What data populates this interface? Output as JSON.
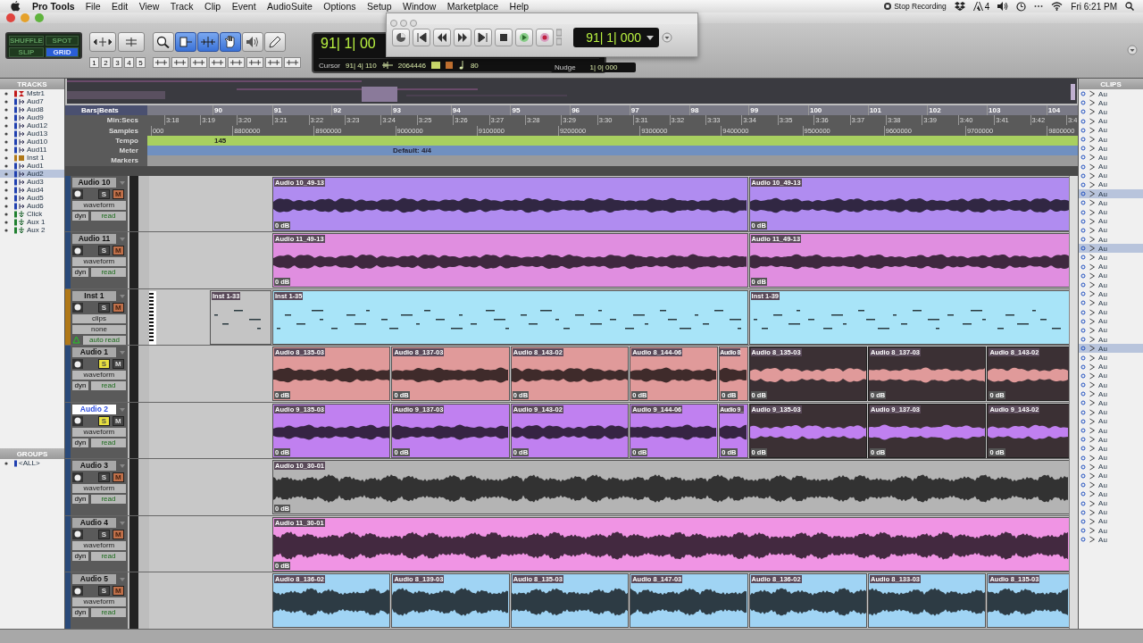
{
  "menu_bar": {
    "app": "Pro Tools",
    "menus": [
      "File",
      "Edit",
      "View",
      "Track",
      "Clip",
      "Event",
      "AudioSuite",
      "Options",
      "Setup",
      "Window",
      "Marketplace",
      "Help"
    ],
    "status": {
      "recording": "Stop Recording",
      "adobe_count": "4",
      "clock": "Fri 6:21 PM"
    }
  },
  "toolbar": {
    "edit_modes": [
      {
        "label": "SHUFFLE",
        "selected": false
      },
      {
        "label": "SPOT",
        "selected": false
      },
      {
        "label": "SLIP",
        "selected": false
      },
      {
        "label": "GRID",
        "selected": true
      }
    ],
    "zoom_presets": [
      "1",
      "2",
      "3",
      "4",
      "5"
    ],
    "tools": [
      {
        "kind": "zoom",
        "selected": false
      },
      {
        "kind": "trim",
        "selected": true
      },
      {
        "kind": "selector",
        "selected": true
      },
      {
        "kind": "grabber",
        "selected": true
      },
      {
        "kind": "scrub",
        "selected": false
      },
      {
        "kind": "pencil",
        "selected": false
      }
    ],
    "main_counter": "91| 1| 00",
    "cursor_label": "Cursor",
    "cursor_position": "91| 4| 110",
    "cursor_sample": "2064446",
    "tempo": "80"
  },
  "nudge": {
    "label": "Nudge",
    "value": "1| 0| 000"
  },
  "transport": {
    "counter": "91| 1| 000"
  },
  "tracks_panel": {
    "title": "TRACKS",
    "items": [
      {
        "label": "Mstr1",
        "kind": "master",
        "color": "#c01818",
        "selected": false
      },
      {
        "label": "Aud7",
        "kind": "audio",
        "color": "#2040b0",
        "selected": false
      },
      {
        "label": "Aud8",
        "kind": "audio",
        "color": "#2040b0",
        "selected": false
      },
      {
        "label": "Aud9",
        "kind": "audio",
        "color": "#2040b0",
        "selected": false
      },
      {
        "label": "Aud12",
        "kind": "audio",
        "color": "#2040b0",
        "selected": false
      },
      {
        "label": "Aud13",
        "kind": "audio",
        "color": "#2040b0",
        "selected": false
      },
      {
        "label": "Aud10",
        "kind": "audio",
        "color": "#2040b0",
        "selected": false
      },
      {
        "label": "Aud11",
        "kind": "audio",
        "color": "#2040b0",
        "selected": false
      },
      {
        "label": "Inst 1",
        "kind": "inst",
        "color": "#b07818",
        "selected": false
      },
      {
        "label": "Aud1",
        "kind": "audio",
        "color": "#2040b0",
        "selected": false
      },
      {
        "label": "Aud2",
        "kind": "audio",
        "color": "#2040b0",
        "selected": true
      },
      {
        "label": "Aud3",
        "kind": "audio",
        "color": "#2040b0",
        "selected": false
      },
      {
        "label": "Aud4",
        "kind": "audio",
        "color": "#2040b0",
        "selected": false
      },
      {
        "label": "Aud5",
        "kind": "audio",
        "color": "#2040b0",
        "selected": false
      },
      {
        "label": "Aud6",
        "kind": "audio",
        "color": "#2040b0",
        "selected": false
      },
      {
        "label": "Click",
        "kind": "aux",
        "color": "#208030",
        "selected": false
      },
      {
        "label": "Aux 1",
        "kind": "aux",
        "color": "#208030",
        "selected": false
      },
      {
        "label": "Aux 2",
        "kind": "aux",
        "color": "#208030",
        "selected": false
      }
    ]
  },
  "groups_panel": {
    "title": "GROUPS",
    "items": [
      {
        "label": "<ALL>"
      }
    ]
  },
  "rulers": [
    {
      "kind": "bars",
      "name": "Bars|Beats",
      "ticks": [
        "90",
        "91",
        "92",
        "93",
        "94",
        "95",
        "96",
        "97",
        "98",
        "99",
        "100",
        "101",
        "102",
        "103",
        "104"
      ]
    },
    {
      "kind": "minsecs",
      "name": "Min:Secs",
      "ticks": [
        "3:18",
        "3:19",
        "3:20",
        "3:21",
        "3:22",
        "3:23",
        "3:24",
        "3:25",
        "3:26",
        "3:27",
        "3:28",
        "3:29",
        "3:30",
        "3:31",
        "3:32",
        "3:33",
        "3:34",
        "3:35",
        "3:36",
        "3:37",
        "3:38",
        "3:39",
        "3:40",
        "3:41",
        "3:42",
        "3:4"
      ]
    },
    {
      "kind": "samples",
      "name": "Samples",
      "ticks": [
        "000",
        "8800000",
        "8900000",
        "9000000",
        "9100000",
        "9200000",
        "9300000",
        "9400000",
        "9500000",
        "9600000",
        "9700000",
        "9800000"
      ]
    },
    {
      "kind": "tempo",
      "name": "Tempo",
      "value": "145"
    },
    {
      "kind": "meter",
      "name": "Meter",
      "value": "Default: 4/4"
    },
    {
      "kind": "markers",
      "name": "Markers"
    }
  ],
  "tracks": [
    {
      "name": "Audio 10",
      "kind": "audio",
      "selected": false,
      "solo_label": "S",
      "mute_label": "M",
      "solo": false,
      "muted": true,
      "view": "waveform",
      "dyn": "dyn",
      "automation": "read",
      "color": "#b08cf0",
      "clips": [
        {
          "name": "Audio 10_49-13",
          "gain": "0 dB",
          "selected": false
        },
        {
          "name": "Audio 10_49-13",
          "gain": "0 dB",
          "selected": false
        }
      ]
    },
    {
      "name": "Audio 11",
      "kind": "audio",
      "selected": false,
      "solo_label": "S",
      "mute_label": "M",
      "solo": false,
      "muted": true,
      "view": "waveform",
      "dyn": "dyn",
      "automation": "read",
      "color": "#e08ee0",
      "clips": [
        {
          "name": "Audio 11_49-13",
          "gain": "0 dB",
          "selected": false
        },
        {
          "name": "Audio 11_49-13",
          "gain": "0 dB",
          "selected": false
        }
      ]
    },
    {
      "name": "Inst 1",
      "kind": "inst",
      "selected": false,
      "solo_label": "S",
      "mute_label": "M",
      "solo": false,
      "muted": true,
      "view": "clips",
      "input": "none",
      "automation": "auto read",
      "color": "#a8e4f8",
      "clips": [
        {
          "name": "Inst 1-33",
          "selected": false,
          "muted_clip": true
        },
        {
          "name": "Inst 1-35",
          "selected": false,
          "muted_clip": false
        },
        {
          "name": "Inst 1-39",
          "selected": false,
          "muted_clip": false
        }
      ]
    },
    {
      "name": "Audio 1",
      "kind": "audio",
      "selected": false,
      "solo_label": "S",
      "mute_label": "M",
      "solo": true,
      "muted": false,
      "view": "waveform",
      "dyn": "dyn",
      "automation": "read",
      "color": "#e09a9a",
      "clips": [
        {
          "name": "Audio 8_135-03",
          "gain": "0 dB",
          "selected": false
        },
        {
          "name": "Audio 8_137-03",
          "gain": "0 dB",
          "selected": false
        },
        {
          "name": "Audio 8_143-02",
          "gain": "0 dB",
          "selected": false
        },
        {
          "name": "Audio 8_144-06",
          "gain": "0 dB",
          "selected": false
        },
        {
          "name": "Audio 8",
          "gain": "0 dB",
          "selected": false
        },
        {
          "name": "Audio 8_135-03",
          "gain": "0 dB",
          "selected": true
        },
        {
          "name": "Audio 8_137-03",
          "gain": "0 dB",
          "selected": true
        },
        {
          "name": "Audio 8_143-02",
          "gain": "0 dB",
          "selected": true
        }
      ]
    },
    {
      "name": "Audio 2",
      "kind": "audio",
      "selected": true,
      "solo_label": "S",
      "mute_label": "M",
      "solo": true,
      "muted": false,
      "view": "waveform",
      "dyn": "dyn",
      "automation": "read",
      "color": "#c080f0",
      "clips": [
        {
          "name": "Audio 9_135-03",
          "gain": "0 dB",
          "selected": false
        },
        {
          "name": "Audio 9_137-03",
          "gain": "0 dB",
          "selected": false
        },
        {
          "name": "Audio 9_143-02",
          "gain": "0 dB",
          "selected": false
        },
        {
          "name": "Audio 9_144-06",
          "gain": "0 dB",
          "selected": false
        },
        {
          "name": "Audio 9_",
          "gain": "0 dB",
          "selected": false
        },
        {
          "name": "Audio 9_135-03",
          "gain": "0 dB",
          "selected": true
        },
        {
          "name": "Audio 9_137-03",
          "gain": "0 dB",
          "selected": true
        },
        {
          "name": "Audio 9_143-02",
          "gain": "0 dB",
          "selected": true
        }
      ]
    },
    {
      "name": "Audio 3",
      "kind": "audio",
      "selected": false,
      "solo_label": "S",
      "mute_label": "M",
      "solo": false,
      "muted": true,
      "view": "waveform",
      "dyn": "dyn",
      "automation": "read",
      "color": "#b4b4b4",
      "clips": [
        {
          "name": "Audio 10_30-01",
          "gain": "0 dB",
          "selected": false
        }
      ]
    },
    {
      "name": "Audio 4",
      "kind": "audio",
      "selected": false,
      "solo_label": "S",
      "mute_label": "M",
      "solo": false,
      "muted": true,
      "view": "waveform",
      "dyn": "dyn",
      "automation": "read",
      "color": "#f094e4",
      "clips": [
        {
          "name": "Audio 11_30-01",
          "gain": "0 dB",
          "selected": false
        }
      ]
    },
    {
      "name": "Audio 5",
      "kind": "audio",
      "selected": false,
      "solo_label": "S",
      "mute_label": "M",
      "solo": false,
      "muted": true,
      "view": "waveform",
      "dyn": "dyn",
      "automation": "read",
      "color": "#a0d4f4",
      "clips": [
        {
          "name": "Audio 8_136-02",
          "selected": false
        },
        {
          "name": "Audio 8_139-03",
          "selected": false
        },
        {
          "name": "Audio 8_135-03",
          "selected": false
        },
        {
          "name": "Audio 8_147-03",
          "selected": false
        },
        {
          "name": "Audio 8_136-02",
          "selected": false
        },
        {
          "name": "Audio 8_133-03",
          "selected": false
        },
        {
          "name": "Audio 8_135-03",
          "selected": false
        }
      ]
    }
  ],
  "clips_panel": {
    "title": "CLIPS",
    "items": [
      {
        "label": "Au",
        "selected": false
      },
      {
        "label": "Au",
        "selected": false
      },
      {
        "label": "Au",
        "selected": false
      },
      {
        "label": "Au",
        "selected": false
      },
      {
        "label": "Au",
        "selected": false
      },
      {
        "label": "Au",
        "selected": false
      },
      {
        "label": "Au",
        "selected": false
      },
      {
        "label": "Au",
        "selected": false
      },
      {
        "label": "Au",
        "selected": false
      },
      {
        "label": "Au",
        "selected": false
      },
      {
        "label": "Au",
        "selected": false
      },
      {
        "label": "Au",
        "selected": true
      },
      {
        "label": "Au",
        "selected": false
      },
      {
        "label": "Au",
        "selected": false
      },
      {
        "label": "Au",
        "selected": false
      },
      {
        "label": "Au",
        "selected": false
      },
      {
        "label": "Au",
        "selected": false
      },
      {
        "label": "Au",
        "selected": true
      },
      {
        "label": "Au",
        "selected": false
      },
      {
        "label": "Au",
        "selected": false
      },
      {
        "label": "Au",
        "selected": false
      },
      {
        "label": "Au",
        "selected": false
      },
      {
        "label": "Au",
        "selected": false
      },
      {
        "label": "Au",
        "selected": false
      },
      {
        "label": "Au",
        "selected": false
      },
      {
        "label": "Au",
        "selected": false
      },
      {
        "label": "Au",
        "selected": false
      },
      {
        "label": "Au",
        "selected": false
      },
      {
        "label": "Au",
        "selected": true
      },
      {
        "label": "Au",
        "selected": false
      },
      {
        "label": "Au",
        "selected": false
      },
      {
        "label": "Au",
        "selected": false
      },
      {
        "label": "Au",
        "selected": false
      },
      {
        "label": "Au",
        "selected": false
      },
      {
        "label": "Au",
        "selected": false
      },
      {
        "label": "Au",
        "selected": false
      },
      {
        "label": "Au",
        "selected": false
      },
      {
        "label": "Au",
        "selected": false
      },
      {
        "label": "Au",
        "selected": false
      },
      {
        "label": "Au",
        "selected": false
      },
      {
        "label": "Au",
        "selected": false
      },
      {
        "label": "Au",
        "selected": false
      },
      {
        "label": "Au",
        "selected": false
      },
      {
        "label": "Au",
        "selected": false
      },
      {
        "label": "Au",
        "selected": false
      },
      {
        "label": "Au",
        "selected": false
      },
      {
        "label": "Au",
        "selected": false
      },
      {
        "label": "Au",
        "selected": false
      },
      {
        "label": "Au",
        "selected": false
      },
      {
        "label": "Au",
        "selected": false
      }
    ]
  }
}
